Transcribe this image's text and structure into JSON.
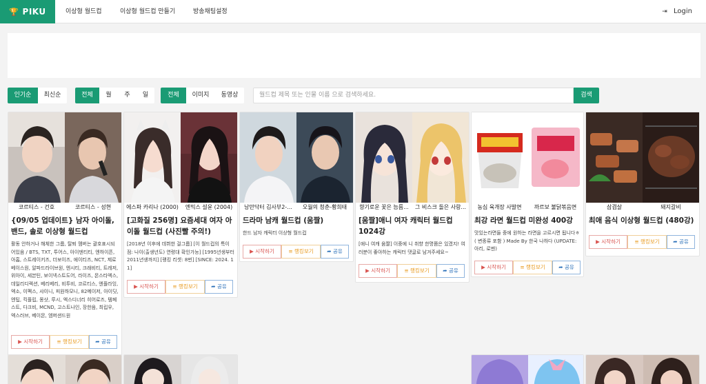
{
  "nav": {
    "logo": "PIKU",
    "links": [
      "이상형 월드컵",
      "이상형 월드컵 만들기",
      "방송채팅설정"
    ],
    "login": "Login"
  },
  "filters": {
    "sort": [
      "인기순",
      "최신순"
    ],
    "period": [
      "전체",
      "월",
      "주",
      "일"
    ],
    "media": [
      "전체",
      "이미지",
      "동영상"
    ],
    "search_placeholder": "월드컵 제목 또는 인물 이름 으로 검색하세요.",
    "search_button": "검색"
  },
  "buttons": {
    "start": "시작하기",
    "rank": "랭킹보기",
    "share": "공유"
  },
  "icons": {
    "play": "▶",
    "list": "≡",
    "share": "➦",
    "trophy": "🏆",
    "login": "⇥"
  },
  "colors": {
    "brand": "#1a9b74",
    "start": "#d9534f",
    "rank": "#e89a1e",
    "share": "#2a6fb8"
  },
  "cards": [
    {
      "left_caption": "코르티스 - 건호",
      "right_caption": "코르티스 - 성현",
      "title": "{09/05 업데이트} 남자 아이돌, 밴드, 솔로 이상형 월드컵",
      "desc": "활동 안하거나 해체한 그룹, 탈퇴 멤버는 괄호표시되어있음 / BTS, TXT, 투어스, 아이덴티티, 엔하이픈, 아홉, 스트레이키즈, 더보이즈, 에이티즈, NCT, 제로베이스원, 알파드라이브원, 엔시티, 크래비티, 트레저, 위아이, 세븐틴, 보이넥스트도어, 라이즈, 몬스타엑스, 데일리디렉션, 베리베리, 비투비, 코르티스, 엔플라잉, 엑소, 이펙스, 샤이니, 피원하모니, 82메이저, 아이딧, 엔팁, 킥플립, 몽샷, 루시, 엑스디너리 히어로즈, 템페스트, 다크비, MCND, 고스트나인, 장한음, 최립우, 엑스러브, 베이몬, 엠퍼샌드원"
    },
    {
      "left_caption": "에스파 카리나 (2000)",
      "right_caption": "엔믹스 설윤 (2004)",
      "title": "[고화질 256명] 요즘세대 여자 아이돌 월드컵 (사진빨 주의!)",
      "desc": "[2018년 이후에 데뷔한 걸그룹] [이 월드컵의 특이점: 나이(출생년도) 연령대 확인가능] [1995년생부터 2011년생까지] [랭킹 리셋: 8번] [SINCE: 2024. 11]"
    },
    {
      "left_caption": "낭만닥터 김사부2-...",
      "right_caption": "오월의 청춘-황희태",
      "title": "드라마 남캐 월드컵 (움짤)",
      "desc": "한드 남자 캐릭터 이상형 월드컵"
    },
    {
      "left_caption": "향기로운 꽃은 늠름...",
      "right_caption": "그 비스크 돌은 사랑...",
      "title": "[움짤]애니 여자 캐릭터 월드컵 1024강",
      "desc": "[애니 여캐 움짤] 이중에 니 취향 한명쯤은 있겠지! 여러분이 좋아하는 캐릭터 댓글로 남겨주세요~"
    },
    {
      "left_caption": "농심 육개장 사발면",
      "right_caption": "까르보 불닭볶음면",
      "title": "최강 라면 월드컵 미완성 400강",
      "desc": "맛있는라면들 중에 원하는 라면을 고르시면 됩니다ㅎ ( 변종류 포함 ) Made By 한국 나하다 (UPDATE: 아리, 로멘)"
    },
    {
      "left_caption": "삼겹살",
      "right_caption": "돼지갈비",
      "title": "최애 음식 이상형 월드컵 (480강)",
      "desc": ""
    }
  ]
}
